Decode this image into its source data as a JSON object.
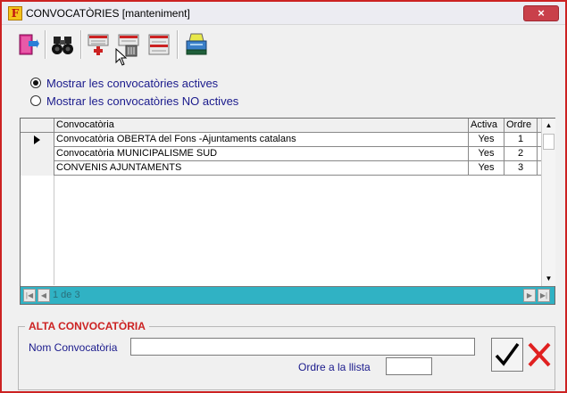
{
  "window": {
    "title": "CONVOCATÒRIES [manteniment]",
    "app_icon_letter": "F",
    "close_label": "×"
  },
  "toolbar": {
    "icons": [
      "exit-door-icon",
      "binoculars-search-icon",
      "add-record-icon",
      "delete-record-icon",
      "edit-record-icon",
      "print-icon"
    ]
  },
  "filters": {
    "option_active": "Mostrar les convocatòries actives",
    "option_inactive": "Mostrar les convocatòries NO actives",
    "selected": "option_active"
  },
  "grid": {
    "columns": {
      "name": "Convocatòria",
      "active": "Activa",
      "order": "Ordre"
    },
    "rows": [
      {
        "name": "Convocatòria OBERTA del Fons -Ajuntaments catalans",
        "active": "Yes",
        "order": "1",
        "current": true
      },
      {
        "name": "Convocatòria MUNICIPALISME SUD",
        "active": "Yes",
        "order": "2",
        "current": false
      },
      {
        "name": "CONVENIS AJUNTAMENTS",
        "active": "Yes",
        "order": "3",
        "current": false
      }
    ],
    "record_position": "1 de 3"
  },
  "form": {
    "section_title": "ALTA CONVOCATÒRIA",
    "name_label": "Nom Convocatòria",
    "name_value": "",
    "order_label": "Ordre a la llista",
    "order_value": ""
  },
  "colors": {
    "accent_red": "#cc2222",
    "label_blue": "#1a1a8c",
    "navbar_teal": "#30b2c4"
  }
}
